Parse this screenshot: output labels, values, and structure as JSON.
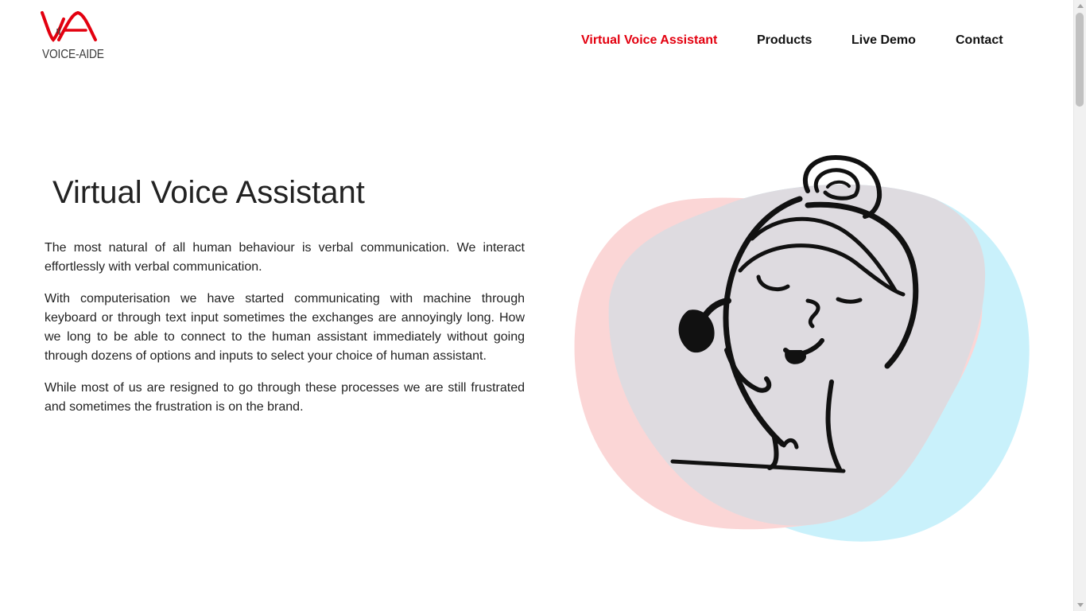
{
  "brand": {
    "name": "VOICE-AIDE",
    "accent_color": "#e3000f"
  },
  "nav": {
    "items": [
      {
        "label": "Virtual Voice Assistant",
        "active": true
      },
      {
        "label": "Products",
        "active": false
      },
      {
        "label": "Live Demo",
        "active": false
      },
      {
        "label": "Contact",
        "active": false
      }
    ]
  },
  "main": {
    "title": "Virtual Voice Assistant",
    "paragraphs": [
      "The most natural of all human behaviour is verbal communication. We interact effortlessly with verbal communication.",
      "With computerisation we have started communicating with machine through keyboard or through text input sometimes the exchanges are annoyingly long. How we long to be able to connect to the human assistant immediately without going through dozens of options and inputs to select your choice of human assistant.",
      "While most of us are resigned to go through these processes we are still frustrated and sometimes the frustration is on the brand."
    ]
  },
  "illustration": {
    "blob_colors": [
      "#fbd6d6",
      "#c9f1fb"
    ]
  }
}
